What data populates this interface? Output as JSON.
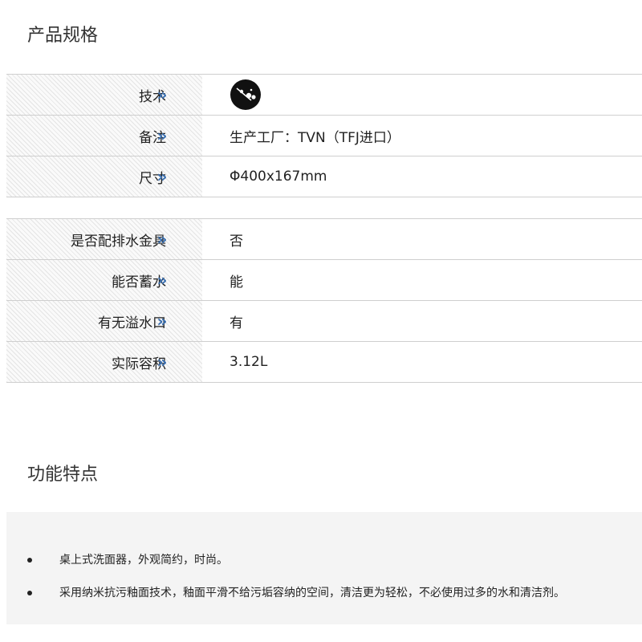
{
  "spec_section": {
    "title": "产品规格",
    "arrow": "»",
    "groups": [
      {
        "rows": [
          {
            "label": "技术",
            "value": "",
            "icon": "tvn-technology-logo-icon"
          },
          {
            "label": "备注",
            "value": "生产工厂：TVN（TFJ进口）"
          },
          {
            "label": "尺寸",
            "value": "Φ400x167mm"
          }
        ]
      },
      {
        "rows": [
          {
            "label": "是否配排水金具",
            "value": "否"
          },
          {
            "label": "能否蓄水",
            "value": "能"
          },
          {
            "label": "有无溢水口",
            "value": "有"
          },
          {
            "label": "实际容积",
            "value": "3.12L"
          }
        ]
      }
    ]
  },
  "feature_section": {
    "title": "功能特点",
    "items": [
      "桌上式洗面器，外观简约，时尚。",
      "采用纳米抗污釉面技术，釉面平滑不给污垢容纳的空间，清洁更为轻松，不必使用过多的水和清洁剂。"
    ]
  },
  "colors": {
    "arrow": "#3a6fb0",
    "divider": "#cfcfcf",
    "feature_background": "#f4f4f4",
    "text": "#222222"
  }
}
